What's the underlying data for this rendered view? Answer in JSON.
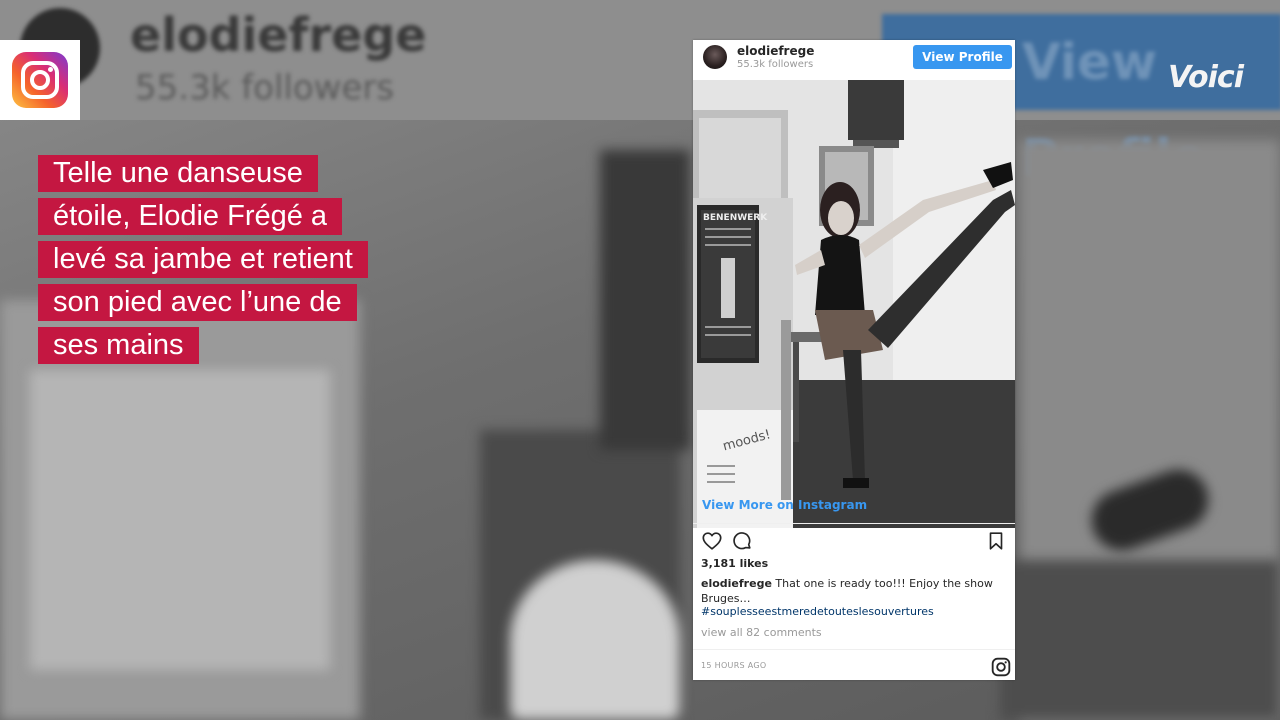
{
  "background": {
    "username": "elodiefrege",
    "followers": "55.3k followers",
    "view_profile_label": "View Profile"
  },
  "brand": {
    "voici_logo": "Voici",
    "instagram_logo_icon": "instagram-logo-icon"
  },
  "caption_lines": [
    "Telle une danseuse",
    "étoile, Elodie Frégé a",
    "levé sa jambe et retient",
    "son pied avec l’une de",
    "ses mains"
  ],
  "post": {
    "username": "elodiefrege",
    "followers": "55.3k followers",
    "view_profile_label": "View Profile",
    "view_more_label": "View More on Instagram",
    "likes": "3,181 likes",
    "caption_user": "elodiefrege",
    "caption_text": "That one is ready too!!! Enjoy the show Bruges…",
    "hashtag": "#souplesseestmeredetouteslesouvertures",
    "comments_link": "view all 82 comments",
    "timestamp": "15 HOURS AGO",
    "photo_poster_title": "BENENWERK",
    "photo_box_text": "moods!",
    "icons": [
      "heart-icon",
      "comment-icon",
      "bookmark-icon",
      "instagram-glyph-icon"
    ]
  },
  "colors": {
    "caption_bg": "#c41741",
    "instagram_blue": "#3897f0",
    "hashtag": "#003569"
  }
}
